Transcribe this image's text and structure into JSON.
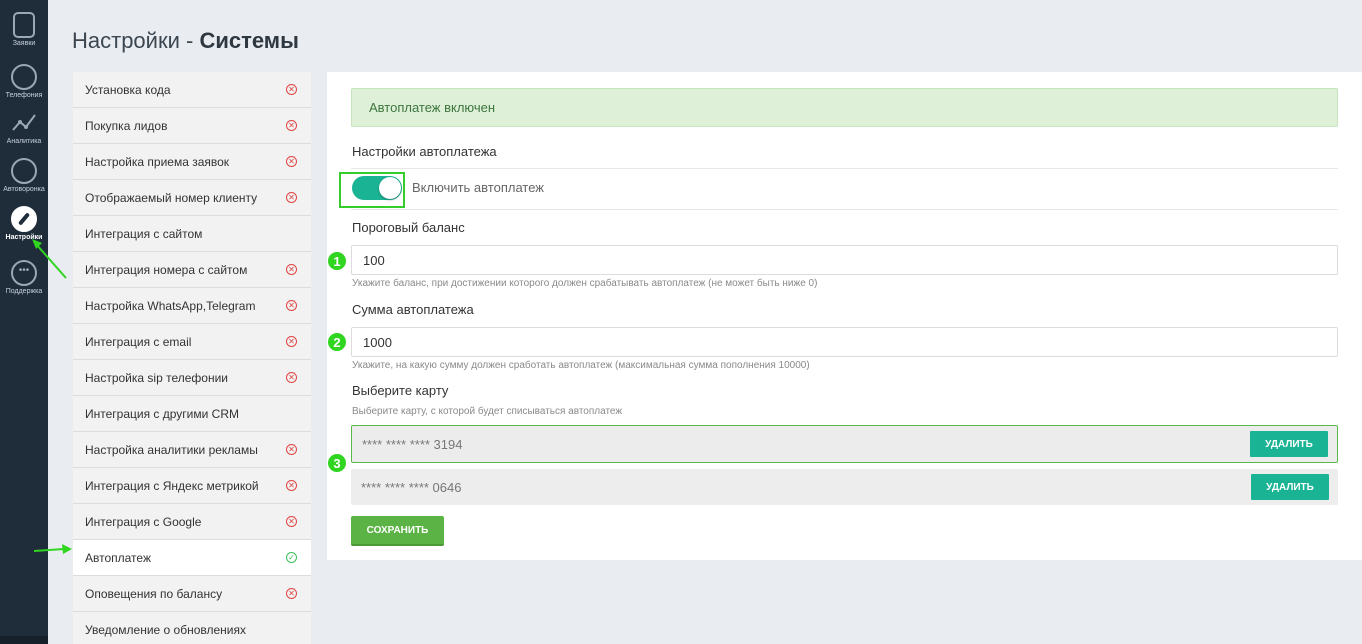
{
  "rail": {
    "items": [
      {
        "label": "Заявки",
        "icon": "clipboard-icon"
      },
      {
        "label": "Телефония",
        "icon": "phone-icon"
      },
      {
        "label": "Аналитика",
        "icon": "analytics-icon"
      },
      {
        "label": "Автоворонка",
        "icon": "mail-icon"
      },
      {
        "label": "Настройки",
        "icon": "wrench-icon",
        "active": true
      },
      {
        "label": "Поддержка",
        "icon": "chat-icon"
      }
    ]
  },
  "page": {
    "title_prefix": "Настройки - ",
    "title_bold": "Системы"
  },
  "menu": {
    "items": [
      {
        "label": "Установка кода",
        "status": "error"
      },
      {
        "label": "Покупка лидов",
        "status": "error"
      },
      {
        "label": "Настройка приема заявок",
        "status": "error"
      },
      {
        "label": "Отображаемый номер клиенту",
        "status": "error"
      },
      {
        "label": "Интеграция с сайтом",
        "status": "none"
      },
      {
        "label": "Интеграция номера с сайтом",
        "status": "error"
      },
      {
        "label": "Настройка WhatsApp,Telegram",
        "status": "error"
      },
      {
        "label": "Интеграция с email",
        "status": "error"
      },
      {
        "label": "Настройка sip телефонии",
        "status": "error"
      },
      {
        "label": "Интеграция с другими CRM",
        "status": "none"
      },
      {
        "label": "Настройка аналитики рекламы",
        "status": "error"
      },
      {
        "label": "Интеграция с Яндекс метрикой",
        "status": "error"
      },
      {
        "label": "Интеграция с Google",
        "status": "error"
      },
      {
        "label": "Автоплатеж",
        "status": "ok",
        "active": true
      },
      {
        "label": "Оповещения по балансу",
        "status": "error"
      },
      {
        "label": "Уведомление о обновлениях",
        "status": "none"
      }
    ]
  },
  "content": {
    "alert": "Автоплатеж включен",
    "section_title": "Настройки автоплатежа",
    "toggle_label": "Включить автоплатеж",
    "toggle_on": true,
    "threshold": {
      "label": "Пороговый баланс",
      "value": "100",
      "hint": "Укажите баланс, при достижении которого должен срабатывать автоплатеж (не может быть ниже 0)"
    },
    "amount": {
      "label": "Сумма автоплатежа",
      "value": "1000",
      "hint": "Укажите, на какую сумму должен сработать автоплатеж (максимальная сумма пополнения 10000)"
    },
    "card_select": {
      "label": "Выберите карту",
      "hint": "Выберите карту, с которой будет списываться автоплатеж",
      "cards": [
        {
          "number": "**** **** **** 3194",
          "delete_label": "УДАЛИТЬ",
          "selected": true
        },
        {
          "number": "**** **** **** 0646",
          "delete_label": "УДАЛИТЬ",
          "selected": false
        }
      ]
    },
    "save_label": "СОХРАНИТЬ"
  },
  "annotations": {
    "badge_1": "1",
    "badge_2": "2",
    "badge_3": "3"
  },
  "colors": {
    "accent": "#1ab394",
    "save": "#5bb346",
    "annotation": "#2fd51f",
    "error": "#e04444",
    "ok": "#3cc05a"
  }
}
